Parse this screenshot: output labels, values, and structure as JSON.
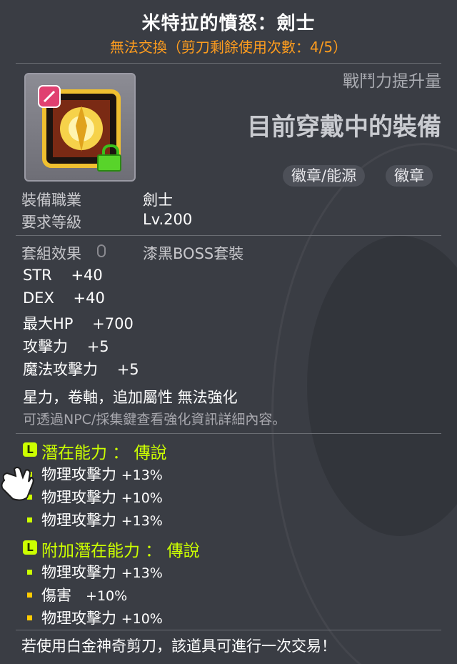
{
  "item": {
    "title": "米特拉的憤怒：劍士",
    "trade_info": "無法交換（剪刀剩餘使用次數：4/5）",
    "combat_power_label": "戰鬥力提升量",
    "equipped_text": "目前穿戴中的裝備",
    "tags": [
      "徽章/能源",
      "徽章"
    ]
  },
  "requirements": [
    {
      "label": "裝備職業",
      "value": "劍士"
    },
    {
      "label": "要求等級",
      "value": "Lv.200"
    }
  ],
  "set_effect": {
    "label": "套組效果",
    "value": "漆黑BOSS套裝"
  },
  "stats": [
    {
      "label": "STR",
      "value": "+40"
    },
    {
      "label": "DEX",
      "value": "+40"
    },
    {
      "label": "最大HP",
      "value": "+700"
    },
    {
      "label": "攻擊力",
      "value": "+5"
    },
    {
      "label": "魔法攻擊力",
      "value": "+5"
    }
  ],
  "enhance_note": "星力，卷軸，追加屬性 無法強化",
  "enhance_hint": "可透過NPC/採集鍵查看強化資訊詳細內容。",
  "potential": {
    "badge": "L",
    "title": "潛在能力 ： 傳說",
    "lines": [
      {
        "name": "物理攻擊力",
        "value": "+13%"
      },
      {
        "name": "物理攻擊力",
        "value": "+10%"
      },
      {
        "name": "物理攻擊力",
        "value": "+13%"
      }
    ]
  },
  "additional_potential": {
    "badge": "L",
    "title": "附加潛在能力 ： 傳說",
    "lines": [
      {
        "name": "物理攻擊力",
        "value": "+13%"
      },
      {
        "name": "傷害",
        "value": "+10%"
      },
      {
        "name": "物理攻擊力",
        "value": "+10%"
      }
    ]
  },
  "footer_note": "若使用白金神奇剪刀，該道具可進行一次交易！",
  "colors": {
    "title": "#ffffff",
    "trade": "#ff9d1e",
    "legendary": "#ccff00",
    "panel": "#3a3d44"
  },
  "icons": [
    "badge-item-icon",
    "lock-icon",
    "legendary-badge-icon",
    "bullet-icon",
    "glove-cursor-icon"
  ]
}
